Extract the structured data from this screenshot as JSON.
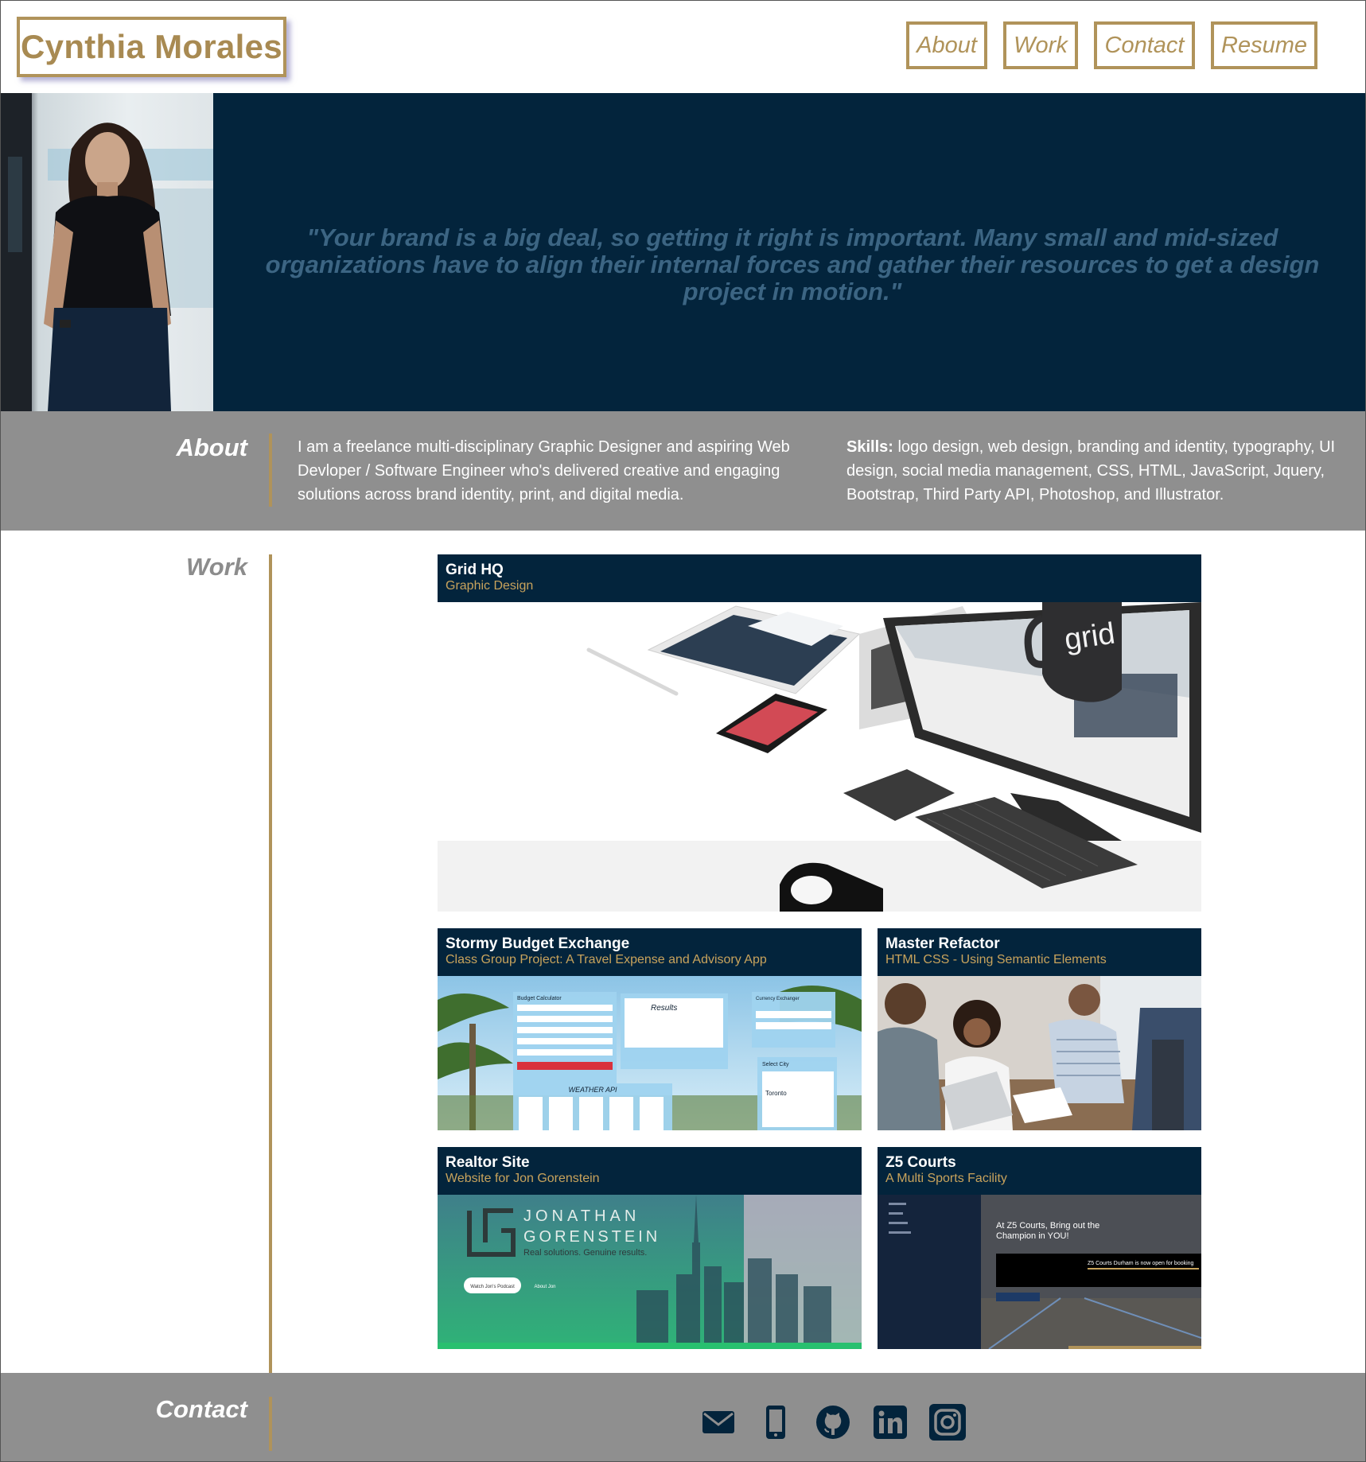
{
  "header": {
    "brand": "Cynthia Morales",
    "nav": [
      "About",
      "Work",
      "Contact",
      "Resume"
    ]
  },
  "hero": {
    "quote": "\"Your brand is a big deal, so getting it right is important. Many small and mid-sized organizations have to align their internal forces and gather their resources to get a design project in motion.\""
  },
  "about": {
    "title": "About",
    "bio": "I am a freelance multi-disciplinary Graphic Designer and aspiring Web Devloper / Software Engineer who's delivered creative and engaging solutions across brand identity, print, and digital media.",
    "skills_label": "Skills:",
    "skills": " logo design, web design, branding and identity, typography, UI design, social media management, CSS, HTML, JavaScript, Jquery, Bootstrap, Third Party API, Photoshop, and Illustrator."
  },
  "work": {
    "title": "Work",
    "projects": [
      {
        "title": "Grid HQ",
        "subtitle": "Graphic Design"
      },
      {
        "title": "Stormy Budget Exchange",
        "subtitle": "Class Group Project: A Travel Expense and Advisory App"
      },
      {
        "title": "Master Refactor",
        "subtitle": "HTML CSS - Using Semantic Elements"
      },
      {
        "title": "Realtor Site",
        "subtitle": "Website for Jon Gorenstein"
      },
      {
        "title": "Z5 Courts",
        "subtitle": "A Multi Sports Facility"
      }
    ],
    "previews": {
      "grid_mug": "grid",
      "budget": {
        "calc": "Budget Calculator",
        "results": "Results",
        "exchanger": "Currency Exchanger",
        "weather": "WEATHER API",
        "city": "Select City",
        "toronto": "Toronto"
      },
      "realtor": {
        "line1": "JONATHAN",
        "line2": "GORENSTEIN",
        "tag": "Real solutions. Genuine results.",
        "btn1": "Watch Jon's Podcast",
        "btn2": "About Jon"
      },
      "z5": {
        "headline": "At Z5 Courts, Bring out the Champion in YOU!",
        "notice": "Z5 Courts Durham is now open for booking"
      }
    }
  },
  "contact": {
    "title": "Contact",
    "icons": [
      "mail-icon",
      "phone-icon",
      "github-icon",
      "linkedin-icon",
      "instagram-icon"
    ]
  },
  "colors": {
    "navy": "#03243c",
    "gold": "#b0935a",
    "gray": "#8f8f8f",
    "quote": "#3c6583"
  }
}
